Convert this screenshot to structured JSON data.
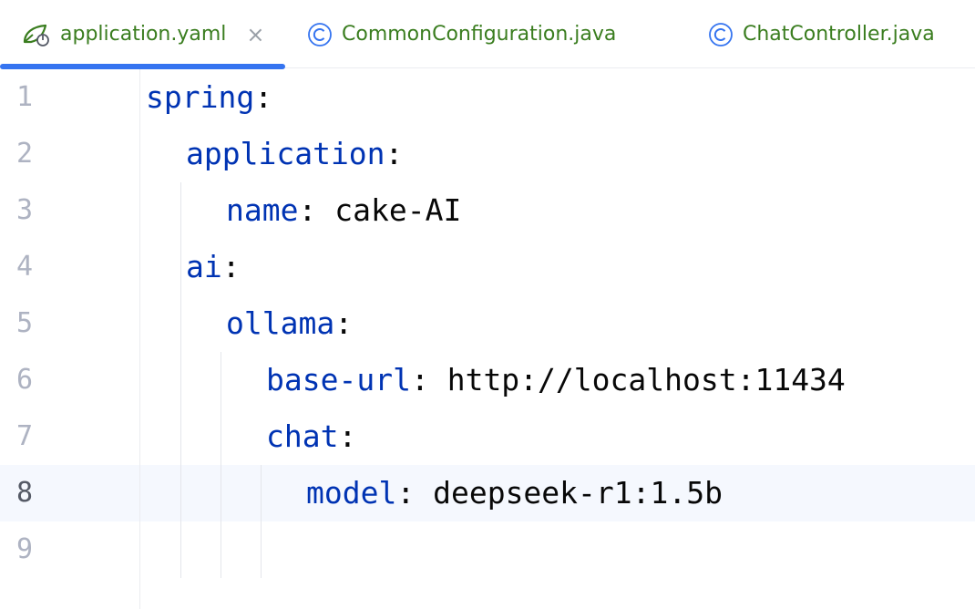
{
  "tabs": [
    {
      "label": "application.yaml",
      "icon": "yaml-spring-icon",
      "active": true,
      "close": "×"
    },
    {
      "label": "CommonConfiguration.java",
      "icon": "java-class-icon",
      "active": false
    },
    {
      "label": "ChatController.java",
      "icon": "java-class-icon",
      "active": false
    }
  ],
  "editor": {
    "current_line": 8,
    "lines": [
      {
        "num": "1",
        "key": "spring",
        "sep": ":",
        "value": ""
      },
      {
        "num": "2",
        "key": "application",
        "sep": ":",
        "value": ""
      },
      {
        "num": "3",
        "key": "name",
        "sep": ": ",
        "value": "cake-AI"
      },
      {
        "num": "4",
        "key": "ai",
        "sep": ":",
        "value": ""
      },
      {
        "num": "5",
        "key": "ollama",
        "sep": ":",
        "value": ""
      },
      {
        "num": "6",
        "key": "base-url",
        "sep": ": ",
        "value": "http://localhost:11434"
      },
      {
        "num": "7",
        "key": "chat",
        "sep": ":",
        "value": ""
      },
      {
        "num": "8",
        "key": "model",
        "sep": ": ",
        "value": "deepseek-r1:1.5b"
      },
      {
        "num": "9",
        "key": "",
        "sep": "",
        "value": ""
      }
    ]
  },
  "colors": {
    "key": "#0033b3",
    "value": "#080808",
    "tab_text": "#3a7d1f",
    "active_tab_underline": "#3574f0",
    "current_line_bg": "#f5f8fe"
  }
}
